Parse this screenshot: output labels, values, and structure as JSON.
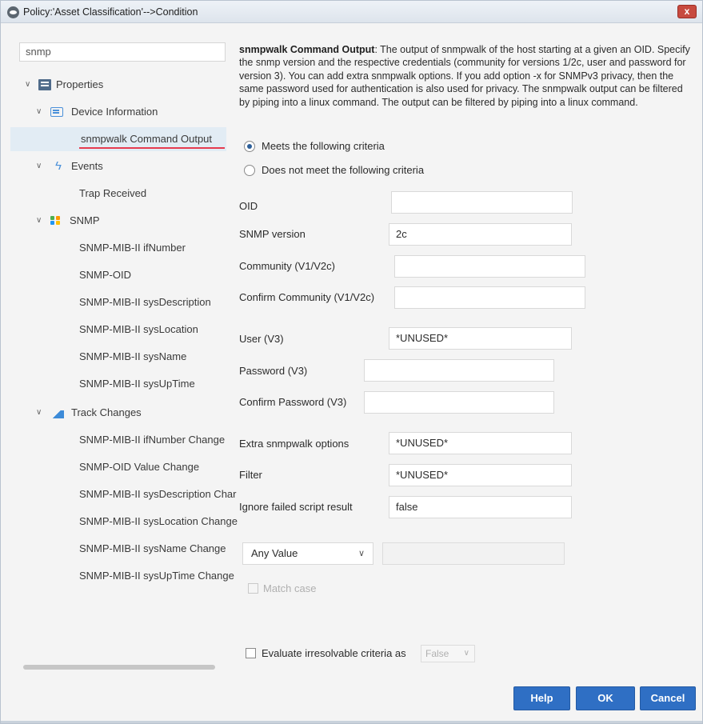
{
  "window": {
    "title": "Policy:'Asset Classification'-->Condition",
    "close_glyph": "x"
  },
  "search": {
    "value": "snmp"
  },
  "tree": {
    "properties": "Properties",
    "device_information": "Device Information",
    "snmpwalk_command_output": "snmpwalk Command Output",
    "events": "Events",
    "trap_received": "Trap Received",
    "snmp": "SNMP",
    "snmp_items": [
      "SNMP-MIB-II ifNumber",
      "SNMP-OID",
      "SNMP-MIB-II sysDescription",
      "SNMP-MIB-II sysLocation",
      "SNMP-MIB-II sysName",
      "SNMP-MIB-II sysUpTime"
    ],
    "track_changes": "Track Changes",
    "track_items": [
      "SNMP-MIB-II ifNumber Change",
      "SNMP-OID Value Change",
      "SNMP-MIB-II sysDescription Char",
      "SNMP-MIB-II sysLocation Change",
      "SNMP-MIB-II sysName Change",
      "SNMP-MIB-II sysUpTime Change"
    ]
  },
  "description": {
    "heading": "snmpwalk Command Output",
    "body": ": The output of snmpwalk of the host starting at a given an OID. Specify the snmp version and the respective credentials (community for versions 1/2c, user and password for version 3). You can add extra snmpwalk options. If you add option -x for SNMPv3 privacy, then the same password used for authentication is also used for privacy. The snmpwalk output can be filtered by piping into a linux command. The output can be filtered by piping into a linux command."
  },
  "criteria": {
    "meets": "Meets the following criteria",
    "not_meets": "Does not meet the following criteria",
    "selected": "meets"
  },
  "fields": {
    "oid": {
      "label": "OID",
      "value": ""
    },
    "snmp_version": {
      "label": "SNMP version",
      "value": "2c"
    },
    "community": {
      "label": "Community (V1/V2c)",
      "value": ""
    },
    "confirm_community": {
      "label": "Confirm Community (V1/V2c)",
      "value": ""
    },
    "user": {
      "label": "User (V3)",
      "value": "*UNUSED*"
    },
    "password": {
      "label": "Password (V3)",
      "value": ""
    },
    "confirm_password": {
      "label": "Confirm Password (V3)",
      "value": ""
    },
    "extra_options": {
      "label": "Extra snmpwalk options",
      "value": "*UNUSED*"
    },
    "filter": {
      "label": "Filter",
      "value": "*UNUSED*"
    },
    "ignore_failed": {
      "label": "Ignore failed script result",
      "value": "false"
    }
  },
  "value_match": {
    "operator": "Any Value",
    "value": "",
    "match_case_label": "Match case"
  },
  "evaluate": {
    "label": "Evaluate irresolvable criteria as",
    "value": "False"
  },
  "buttons": {
    "help": "Help",
    "ok": "OK",
    "cancel": "Cancel"
  },
  "colors": {
    "accent": "#2f6fc4",
    "selection_underline": "#e63b4f",
    "selected_row": "#e2ecf4"
  }
}
